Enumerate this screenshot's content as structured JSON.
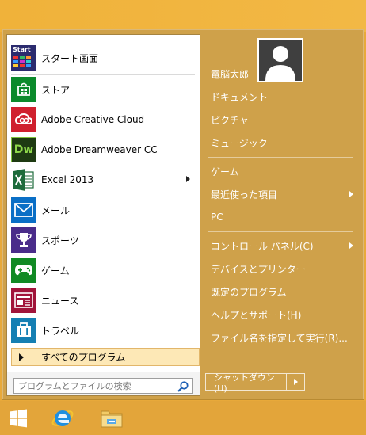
{
  "start_menu": {
    "apps": [
      {
        "label": "スタート画面",
        "icon": "start-screen-icon",
        "color": "#2b2b6e"
      },
      {
        "label": "ストア",
        "icon": "store-icon",
        "color": "#0b8a2b"
      },
      {
        "label": "Adobe Creative Cloud",
        "icon": "creative-cloud-icon",
        "color": "#d0202e"
      },
      {
        "label": "Adobe Dreamweaver CC",
        "icon": "dreamweaver-icon",
        "color": "#1e3a12"
      },
      {
        "label": "Excel 2013",
        "icon": "excel-icon",
        "color": "#1d6b3b"
      },
      {
        "label": "メール",
        "icon": "mail-icon",
        "color": "#0a6fc6"
      },
      {
        "label": "スポーツ",
        "icon": "sports-icon",
        "color": "#4a2c8a"
      },
      {
        "label": "ゲーム",
        "icon": "games-icon",
        "color": "#118a24"
      },
      {
        "label": "ニュース",
        "icon": "news-icon",
        "color": "#a1143a"
      },
      {
        "label": "トラベル",
        "icon": "travel-icon",
        "color": "#157fb3"
      }
    ],
    "start_tile_text": "Start",
    "dreamweaver_tile_text": "Dw",
    "all_programs_label": "すべてのプログラム",
    "search_placeholder": "プログラムとファイルの検索",
    "right_pane": {
      "user_name": "電脳太郎",
      "items_group1": [
        "ドキュメント",
        "ピクチャ",
        "ミュージック"
      ],
      "items_group2": [
        "ゲーム",
        "最近使った項目",
        "PC"
      ],
      "items_group3": [
        "コントロール パネル(C)",
        "デバイスとプリンター",
        "既定のプログラム",
        "ヘルプとサポート(H)",
        "ファイル名を指定して実行(R)..."
      ],
      "shutdown_label": "シャットダウン(U)"
    }
  },
  "taskbar": {
    "items": [
      "windows-logo-icon",
      "internet-explorer-icon",
      "file-explorer-icon"
    ]
  },
  "colors": {
    "accent": "#cfa14a",
    "highlight": "#fde8b6"
  }
}
